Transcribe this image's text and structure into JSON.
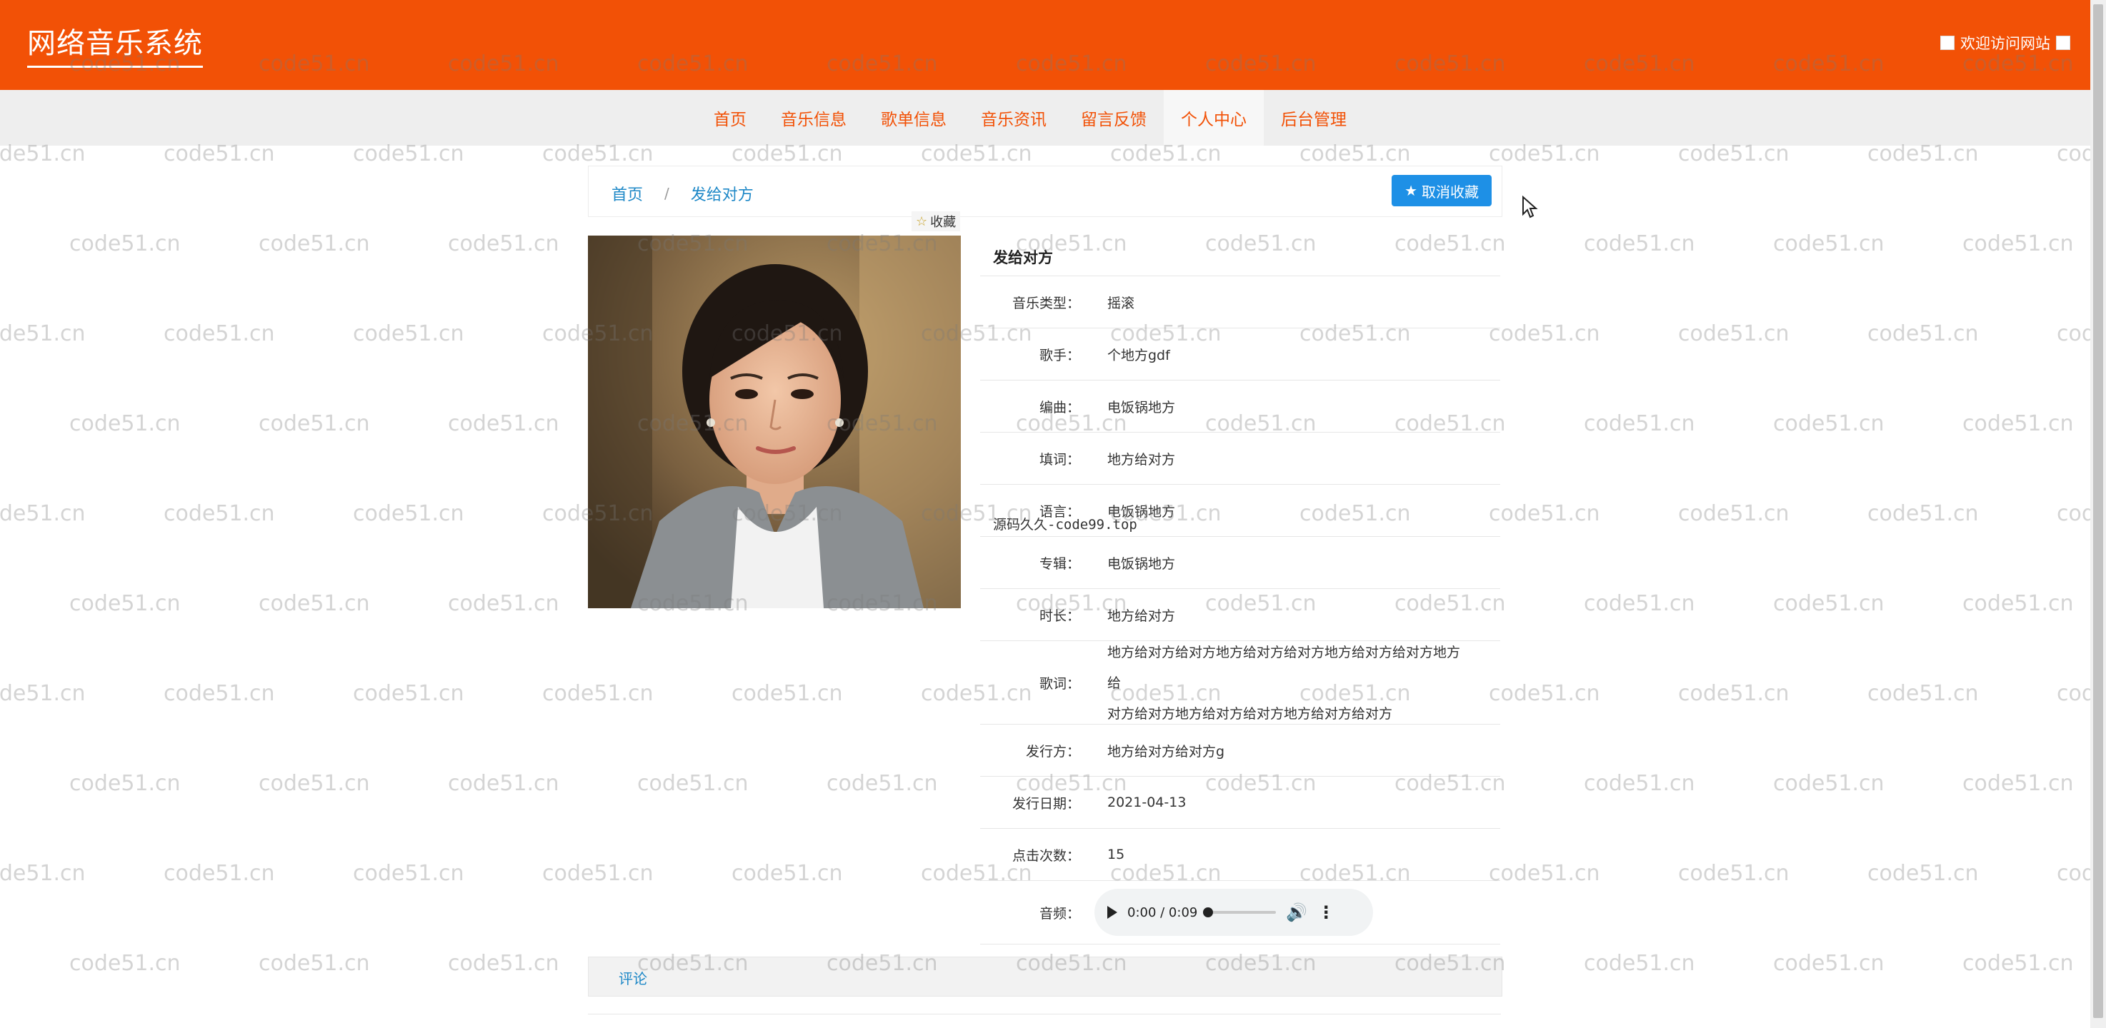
{
  "header": {
    "logo": "网络音乐系统",
    "welcome": "欢迎访问网站",
    "accent_color": "#f25106"
  },
  "nav": {
    "items": [
      {
        "label": "首页",
        "active": false
      },
      {
        "label": "音乐信息",
        "active": false
      },
      {
        "label": "歌单信息",
        "active": false
      },
      {
        "label": "音乐资讯",
        "active": false
      },
      {
        "label": "留言反馈",
        "active": false
      },
      {
        "label": "个人中心",
        "active": true
      },
      {
        "label": "后台管理",
        "active": false
      }
    ]
  },
  "breadcrumb": {
    "home": "首页",
    "separator": "/",
    "current": "发给对方"
  },
  "actions": {
    "uncollect_label": "取消收藏",
    "uncollect_icon": "star-icon",
    "collect_badge": "收藏"
  },
  "song": {
    "title": "发给对方",
    "fields": [
      {
        "label": "音乐类型：",
        "value": "摇滚"
      },
      {
        "label": "歌手：",
        "value": "个地方gdf"
      },
      {
        "label": "编曲：",
        "value": "电饭锅地方"
      },
      {
        "label": "填词：",
        "value": "地方给对方"
      },
      {
        "label": "语言：",
        "value": "电饭锅地方"
      },
      {
        "label": "专辑：",
        "value": "电饭锅地方"
      },
      {
        "label": "时长：",
        "value": "地方给对方"
      }
    ],
    "lyrics_label": "歌词：",
    "lyrics_lines": [
      "地方给对方给对方地方给对方给对方地方给对方给对方地方给",
      "对方给对方地方给对方给对方地方给对方给对方"
    ],
    "fields2": [
      {
        "label": "发行方：",
        "value": "地方给对方给对方g"
      },
      {
        "label": "发行日期：",
        "value": "2021-04-13"
      },
      {
        "label": "点击次数：",
        "value": "15"
      }
    ],
    "audio_label": "音频：",
    "audio_time": "0:00 / 0:09",
    "audio_progress": 0
  },
  "overlay_text": "源码久久-code99.top",
  "comments": {
    "tab_label": "评论"
  },
  "watermark": "code51.cn"
}
